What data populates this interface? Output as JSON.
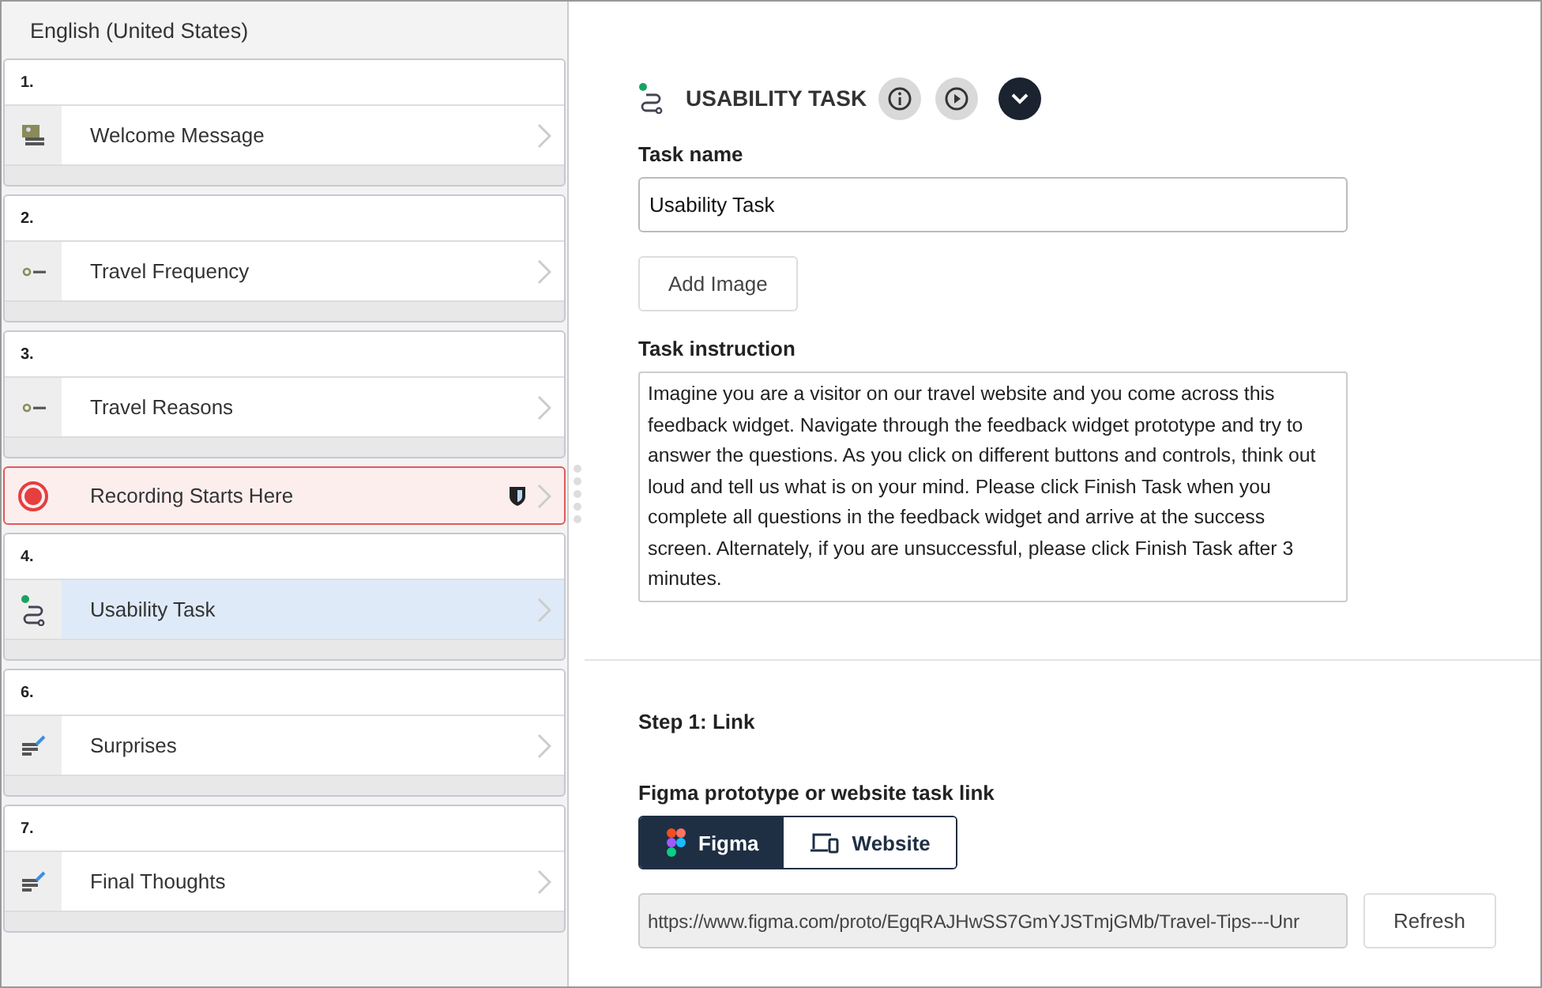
{
  "sidebar": {
    "language": "English (United States)",
    "items": [
      {
        "kind": "message",
        "number": "1.",
        "label": "Welcome Message",
        "selected": false
      },
      {
        "kind": "slider",
        "number": "2.",
        "label": "Travel Frequency",
        "selected": false
      },
      {
        "kind": "slider",
        "number": "3.",
        "label": "Travel Reasons",
        "selected": false
      },
      {
        "kind": "recording",
        "label": "Recording Starts Here",
        "selected": false
      },
      {
        "kind": "task",
        "number": "4.",
        "label": "Usability Task",
        "selected": true
      },
      {
        "kind": "text",
        "number": "6.",
        "label": "Surprises",
        "selected": false
      },
      {
        "kind": "text",
        "number": "7.",
        "label": "Final Thoughts",
        "selected": false
      }
    ]
  },
  "editor": {
    "title": "USABILITY TASK",
    "task_name": {
      "label": "Task name",
      "value": "Usability Task"
    },
    "add_image": "Add Image",
    "instruction": {
      "label": "Task instruction",
      "value": "Imagine you are a visitor on our travel website and you come across this feedback widget. Navigate through the feedback widget prototype and try to answer the questions. As you click on different buttons and controls, think out loud and tell us what is on your mind. Please click Finish Task when you complete all questions in the feedback widget and arrive at the success screen. Alternately, if you are unsuccessful, please click Finish Task after 3 minutes."
    },
    "step": "Step 1: Link",
    "link_label": "Figma prototype or website task link",
    "link_types": [
      {
        "kind": "figma",
        "label": "Figma",
        "selected": true
      },
      {
        "kind": "website",
        "label": "Website",
        "selected": false
      }
    ],
    "url": "https://www.figma.com/proto/EgqRAJHwSS7GmYJSTmjGMb/Travel-Tips---Unr",
    "refresh": "Refresh"
  }
}
